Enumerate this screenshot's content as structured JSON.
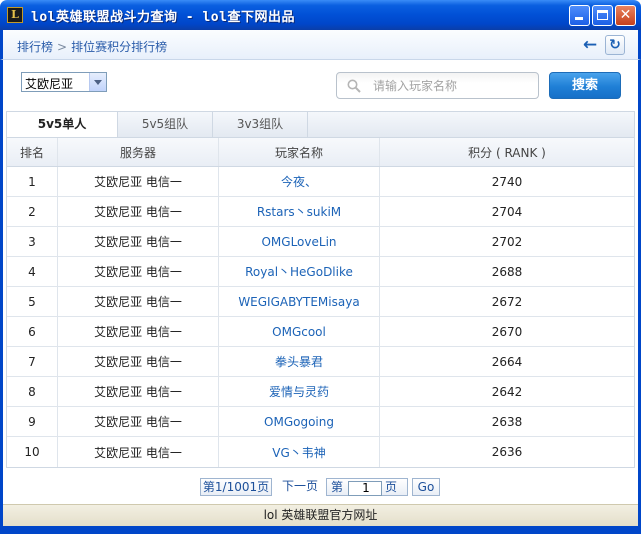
{
  "window": {
    "title": "lol英雄联盟战斗力查询 - lol查下网出品",
    "icon_letter": "L"
  },
  "breadcrumb": {
    "root": "排行榜",
    "separator": ">",
    "current": "排位赛积分排行榜"
  },
  "toolbar": {
    "back_icon": "arrow-left-icon",
    "refresh_icon": "refresh-icon"
  },
  "server_select": {
    "value": "艾欧尼亚"
  },
  "search": {
    "placeholder": "请输入玩家名称",
    "button_label": "搜索"
  },
  "tabs": [
    {
      "label": "5v5单人",
      "active": true
    },
    {
      "label": "5v5组队",
      "active": false
    },
    {
      "label": "3v3组队",
      "active": false
    }
  ],
  "table": {
    "headers": [
      "排名",
      "服务器",
      "玩家名称",
      "积分 ( RANK )"
    ],
    "rows": [
      {
        "rank": "1",
        "server": "艾欧尼亚  电信一",
        "player": "今夜、",
        "score": "2740"
      },
      {
        "rank": "2",
        "server": "艾欧尼亚  电信一",
        "player": "Rstars丶sukiM",
        "score": "2704"
      },
      {
        "rank": "3",
        "server": "艾欧尼亚  电信一",
        "player": "OMGLoveLin",
        "score": "2702"
      },
      {
        "rank": "4",
        "server": "艾欧尼亚  电信一",
        "player": "Royal丶HeGoDlike",
        "score": "2688"
      },
      {
        "rank": "5",
        "server": "艾欧尼亚  电信一",
        "player": "WEGIGABYTEMisaya",
        "score": "2672"
      },
      {
        "rank": "6",
        "server": "艾欧尼亚  电信一",
        "player": "OMGcool",
        "score": "2670"
      },
      {
        "rank": "7",
        "server": "艾欧尼亚  电信一",
        "player": "拳头暴君",
        "score": "2664"
      },
      {
        "rank": "8",
        "server": "艾欧尼亚  电信一",
        "player": "爱情与灵药",
        "score": "2642"
      },
      {
        "rank": "9",
        "server": "艾欧尼亚  电信一",
        "player": "OMGogoing",
        "score": "2638"
      },
      {
        "rank": "10",
        "server": "艾欧尼亚  电信一",
        "player": "VG丶韦神",
        "score": "2636"
      }
    ]
  },
  "pager": {
    "page_info": "第1/1001页",
    "next": "下一页",
    "goto_prefix": "第",
    "goto_value": "1",
    "goto_suffix": "页",
    "go": "Go"
  },
  "footer": {
    "text": "lol 英雄联盟官方网址"
  },
  "colors": {
    "titlebar": "#0150d6",
    "link": "#1c63b7",
    "search_button": "#1f7fd6"
  }
}
